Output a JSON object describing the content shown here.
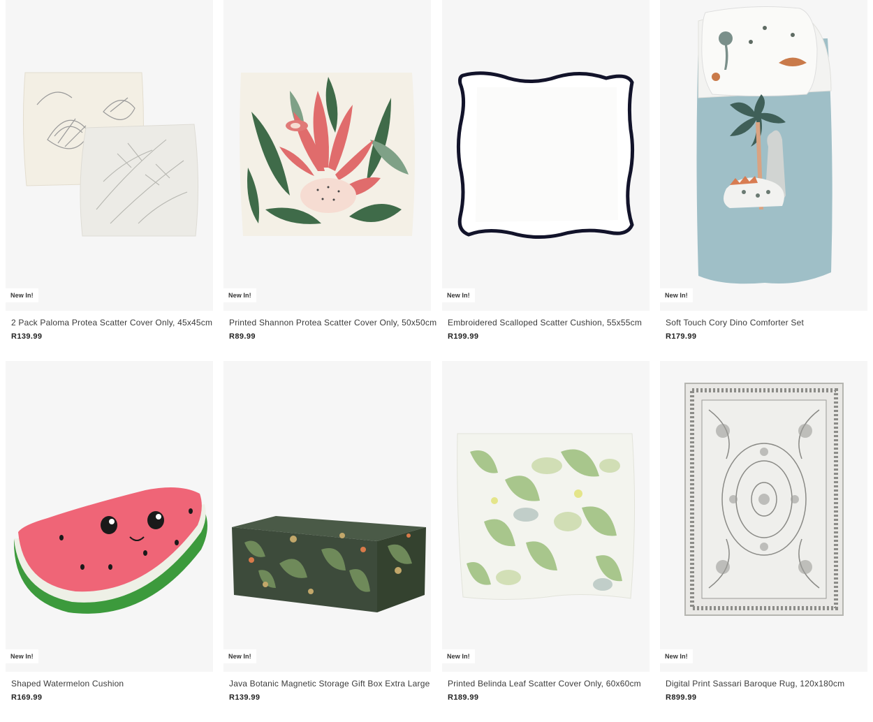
{
  "products": [
    {
      "badge": "New In!",
      "title": "2 Pack Paloma Protea Scatter Cover Only, 45x45cm",
      "price": "R139.99",
      "image": "protea-sketch-cushions"
    },
    {
      "badge": "New In!",
      "title": "Printed Shannon Protea Scatter Cover Only, 50x50cm",
      "price": "R89.99",
      "image": "pink-protea-cushion"
    },
    {
      "badge": "New In!",
      "title": "Embroidered Scalloped Scatter Cushion, 55x55cm",
      "price": "R199.99",
      "image": "white-scalloped-cushion"
    },
    {
      "badge": "New In!",
      "title": "Soft Touch Cory Dino Comforter Set",
      "price": "R179.99",
      "image": "dino-comforter"
    },
    {
      "badge": "New In!",
      "title": "Shaped Watermelon Cushion",
      "price": "R169.99",
      "image": "watermelon-cushion"
    },
    {
      "badge": "New In!",
      "title": "Java Botanic Magnetic Storage Gift Box Extra Large",
      "price": "R139.99",
      "image": "botanic-gift-box"
    },
    {
      "badge": "New In!",
      "title": "Printed Belinda Leaf Scatter Cover Only, 60x60cm",
      "price": "R189.99",
      "image": "leaf-cushion"
    },
    {
      "badge": "New In!",
      "title": "Digital Print Sassari Baroque Rug, 120x180cm",
      "price": "R899.99",
      "image": "baroque-rug"
    }
  ],
  "colors": {
    "image_bg": "#f6f6f6",
    "text": "#3a3a3a"
  }
}
